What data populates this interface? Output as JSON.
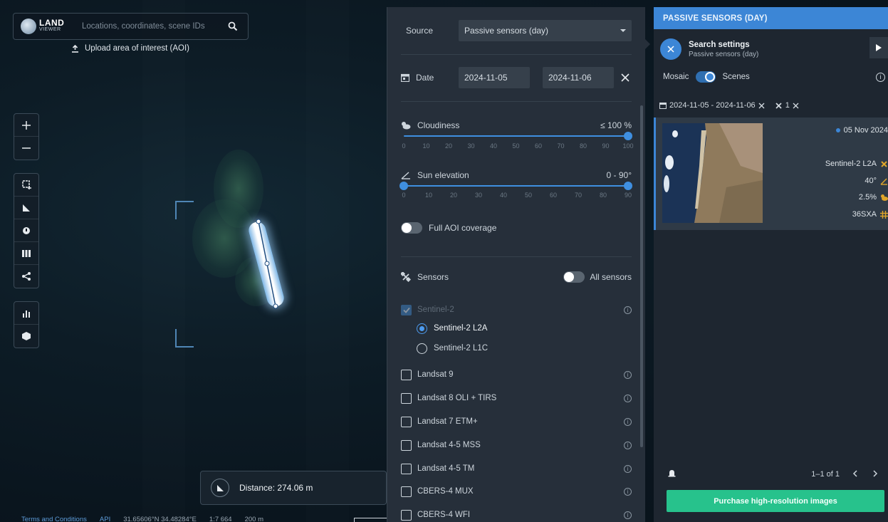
{
  "search": {
    "logo_title": "LAND",
    "logo_subtitle": "VIEWER",
    "placeholder": "Locations, coordinates, scene IDs"
  },
  "upload_aoi_label": "Upload area of interest (AOI)",
  "measurement": {
    "distance_label": "Distance: 274.06 m"
  },
  "footer": {
    "terms": "Terms and Conditions",
    "api": "API",
    "coords": "31.65606°N 34.48284°E",
    "scale": "1:7 664",
    "scale_bar": "200 m"
  },
  "search_panel": {
    "source_label": "Source",
    "source_value": "Passive sensors (day)",
    "date_label": "Date",
    "date_from": "2024-11-05",
    "date_to": "2024-11-06",
    "cloudiness_label": "Cloudiness",
    "cloudiness_value": "≤ 100 %",
    "cloudiness_level": 1.0,
    "cloud_ticks": [
      "0",
      "10",
      "20",
      "30",
      "40",
      "50",
      "60",
      "70",
      "80",
      "90",
      "100"
    ],
    "sun_label": "Sun elevation",
    "sun_value": "0 - 90°",
    "sun_range": [
      0,
      90
    ],
    "sun_ticks": [
      "0",
      "10",
      "20",
      "30",
      "40",
      "50",
      "60",
      "70",
      "80",
      "90"
    ],
    "full_aoi_label": "Full AOI coverage",
    "sensors_label": "Sensors",
    "all_sensors_label": "All sensors",
    "sentinel2": "Sentinel-2",
    "sentinel2_l2a": "Sentinel-2 L2A",
    "sentinel2_l1c": "Sentinel-2 L1C",
    "sensors": [
      "Landsat 9",
      "Landsat 8 OLI + TIRS",
      "Landsat 7 ETM+",
      "Landsat 4-5 MSS",
      "Landsat 4-5 TM",
      "CBERS-4 MUX",
      "CBERS-4 WFI"
    ]
  },
  "results": {
    "header": "PASSIVE SENSORS (DAY)",
    "settings_title": "Search settings",
    "settings_subtitle": "Passive sensors (day)",
    "mosaic_label": "Mosaic",
    "scenes_label": "Scenes",
    "date_chip": "2024-11-05 - 2024-11-06",
    "sensor_chip": "1",
    "scene": {
      "date": "05 Nov 2024",
      "sensor": "Sentinel-2  L2A",
      "sun_elevation": "40°",
      "cloudiness": "2.5%",
      "tile": "36SXA"
    },
    "pagination": "1–1 of 1",
    "purchase_label": "Purchase high-resolution images"
  },
  "colors": {
    "accent": "#3c86d6",
    "purchase": "#27c28c",
    "sensor_icon": "#e0a52a"
  },
  "icons": [
    "search-icon",
    "upload-icon",
    "zoom-in-icon",
    "zoom-out-icon",
    "draw-aoi-icon",
    "ruler-icon",
    "timelapse-icon",
    "layers-icon",
    "share-icon",
    "analytics-icon",
    "3d-icon",
    "calendar-icon",
    "cloud-sun-icon",
    "sun-angle-icon",
    "satellite-icon",
    "info-icon",
    "close-icon",
    "play-icon",
    "bell-icon",
    "chevron-left-icon",
    "chevron-right-icon",
    "tile-grid-icon"
  ]
}
